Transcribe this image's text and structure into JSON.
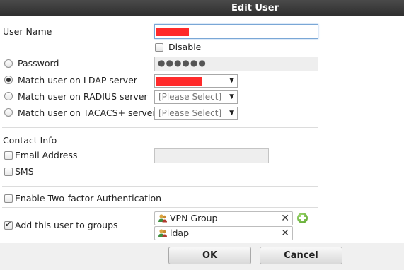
{
  "dialog": {
    "title": "Edit User"
  },
  "form": {
    "user_name_label": "User Name",
    "disable_label": "Disable",
    "password_label": "Password",
    "password_value": "●●●●●●",
    "ldap_label": "Match user on LDAP server",
    "radius_label": "Match user on RADIUS server",
    "radius_value": "[Please Select]",
    "tacacs_label": "Match user on TACACS+ server",
    "tacacs_value": "[Please Select]",
    "auth_selected": "ldap",
    "disable_checked": false
  },
  "contact": {
    "section_label": "Contact Info",
    "email_label": "Email Address",
    "email_checked": false,
    "sms_label": "SMS",
    "sms_checked": false
  },
  "two_factor": {
    "label": "Enable Two-factor Authentication",
    "checked": false
  },
  "groups": {
    "label": "Add this user to groups",
    "checked": true,
    "items": [
      {
        "name": "VPN Group"
      },
      {
        "name": "ldap"
      }
    ]
  },
  "buttons": {
    "ok": "OK",
    "cancel": "Cancel"
  },
  "icons": {
    "group": "user-group-icon",
    "remove": "close-icon",
    "add": "add-icon",
    "dropdown": "chevron-down-icon"
  },
  "colors": {
    "redaction": "#ff2a2a",
    "title_bar": "#3a3a3a",
    "focus_border": "#7aa7d6",
    "add_green": "#4c9a1e"
  }
}
